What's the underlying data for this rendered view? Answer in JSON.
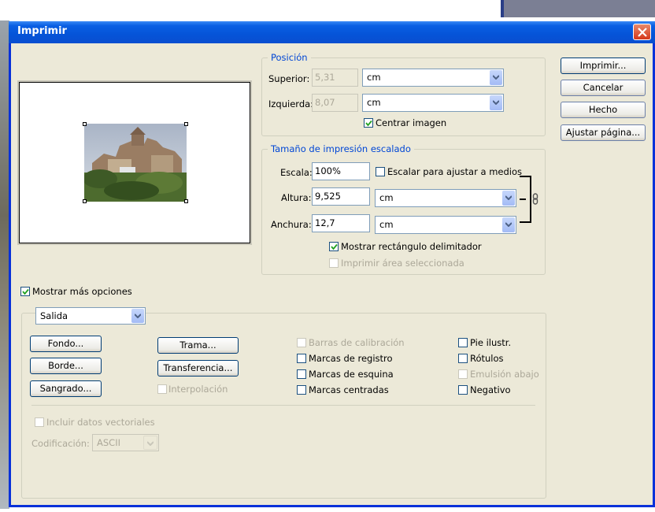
{
  "window": {
    "title": "Imprimir"
  },
  "position": {
    "legend": "Posición",
    "top_label": "Superior:",
    "top_value": "5,31",
    "top_unit": "cm",
    "left_label": "Izquierda:",
    "left_value": "8,07",
    "left_unit": "cm",
    "center_label": "Centrar imagen",
    "center_checked": true
  },
  "scale": {
    "legend": "Tamaño de impresión escalado",
    "scale_label": "Escala:",
    "scale_value": "100%",
    "fit_label": "Escalar para ajustar a medios",
    "fit_checked": false,
    "height_label": "Altura:",
    "height_value": "9,525",
    "height_unit": "cm",
    "width_label": "Anchura:",
    "width_value": "12,7",
    "width_unit": "cm",
    "bounding_label": "Mostrar rectángulo delimitador",
    "bounding_checked": true,
    "selected_label": "Imprimir área seleccionada",
    "selected_checked": false
  },
  "buttons": {
    "print": "Imprimir...",
    "cancel": "Cancelar",
    "done": "Hecho",
    "page_setup": "Ajustar página..."
  },
  "more_options": {
    "label": "Mostrar más opciones",
    "checked": true
  },
  "output": {
    "selected": "Salida",
    "background_btn": "Fondo...",
    "border_btn": "Borde...",
    "bleed_btn": "Sangrado...",
    "screen_btn": "Trama...",
    "transfer_btn": "Transferencia...",
    "interpolation": "Interpolación",
    "calibration_bars": "Barras de calibración",
    "registration_marks": "Marcas de registro",
    "corner_crop_marks": "Marcas de esquina",
    "center_crop_marks": "Marcas centradas",
    "caption": "Pie ilustr.",
    "labels": "Rótulos",
    "emulsion_down": "Emulsión abajo",
    "negative": "Negativo",
    "include_vector": "Incluir datos vectoriales",
    "encoding_label": "Codificación:",
    "encoding_value": "ASCII"
  },
  "colors": {
    "accent": "#0046d5",
    "titlebar": "#0a5fe3",
    "dialog": "#ece9d8"
  }
}
